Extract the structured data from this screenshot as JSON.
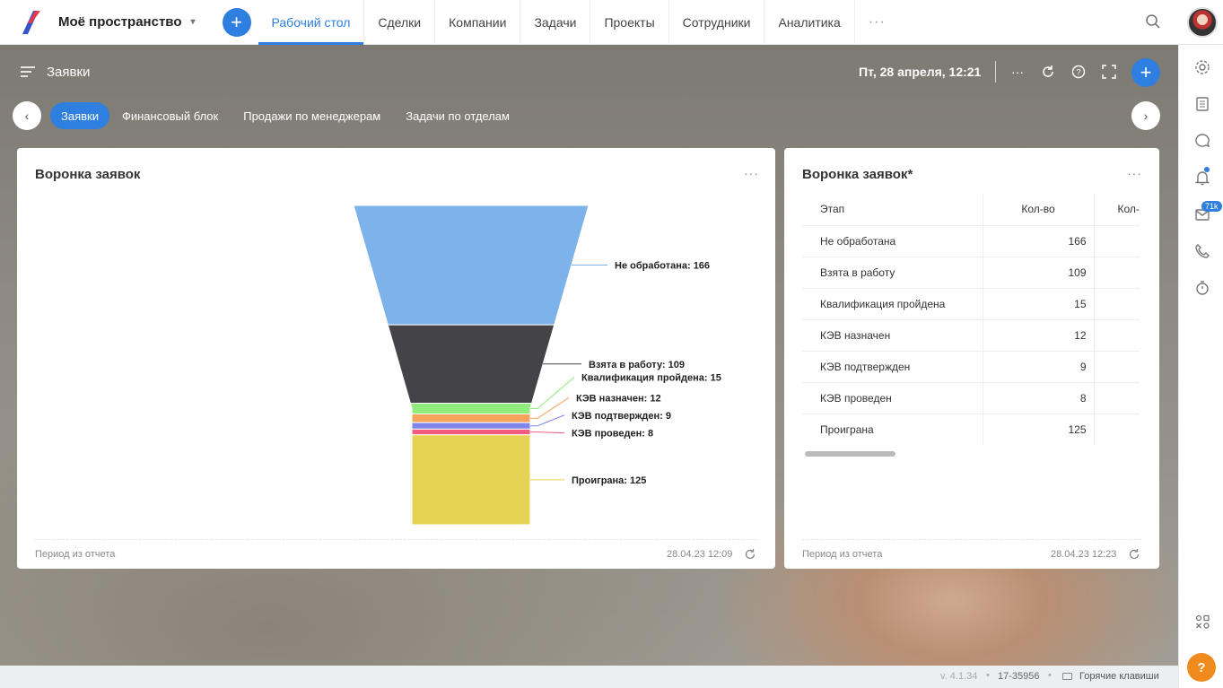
{
  "topbar": {
    "workspace": "Моё пространство",
    "nav": [
      {
        "label": "Рабочий стол",
        "active": true
      },
      {
        "label": "Сделки"
      },
      {
        "label": "Компании"
      },
      {
        "label": "Задачи"
      },
      {
        "label": "Проекты"
      },
      {
        "label": "Сотрудники"
      },
      {
        "label": "Аналитика"
      }
    ],
    "more": "···"
  },
  "dashboard": {
    "title": "Заявки",
    "datetime": "Пт, 28 апреля, 12:21",
    "more": "···"
  },
  "tabs": [
    {
      "label": "Заявки",
      "active": true
    },
    {
      "label": "Финансовый блок"
    },
    {
      "label": "Продажи по менеджерам"
    },
    {
      "label": "Задачи по отделам"
    }
  ],
  "card1": {
    "title": "Воронка заявок",
    "more": "···",
    "footer_left": "Период из отчета",
    "footer_right": "28.04.23 12:09"
  },
  "card2": {
    "title": "Воронка заявок*",
    "more": "···",
    "footer_left": "Период из отчета",
    "footer_right": "28.04.23 12:23",
    "columns": [
      "Этап",
      "Кол-во",
      "Кол-"
    ],
    "rows": [
      [
        "Не обработана",
        "166"
      ],
      [
        "Взята в работу",
        "109"
      ],
      [
        "Квалификация пройдена",
        "15"
      ],
      [
        "КЭВ назначен",
        "12"
      ],
      [
        "КЭВ подтвержден",
        "9"
      ],
      [
        "КЭВ проведен",
        "8"
      ],
      [
        "Проиграна",
        "125"
      ]
    ]
  },
  "chart_data": {
    "type": "funnel",
    "stages": [
      {
        "name": "Не обработана",
        "value": 166,
        "color": "#7db3ea",
        "label": "Не обработана: 166"
      },
      {
        "name": "Взята в работу",
        "value": 109,
        "color": "#434348",
        "label": "Взята в работу: 109"
      },
      {
        "name": "Квалификация пройдена",
        "value": 15,
        "color": "#90ed7d",
        "label": "Квалификация пройдена: 15"
      },
      {
        "name": "КЭВ назначен",
        "value": 12,
        "color": "#f7a35c",
        "label": "КЭВ назначен: 12"
      },
      {
        "name": "КЭВ подтвержден",
        "value": 9,
        "color": "#8085e9",
        "label": "КЭВ подтвержден: 9"
      },
      {
        "name": "КЭВ проведен",
        "value": 8,
        "color": "#f15c80",
        "label": "КЭВ проведен: 8"
      },
      {
        "name": "Проиграна",
        "value": 125,
        "color": "#e4d354",
        "label": "Проиграна: 125"
      }
    ]
  },
  "sidebar": {
    "mail_badge": "71k"
  },
  "status": {
    "version": "v. 4.1.34",
    "sep": "•",
    "build": "17-35956",
    "hotkeys": "Горячие клавиши"
  },
  "help": "?"
}
